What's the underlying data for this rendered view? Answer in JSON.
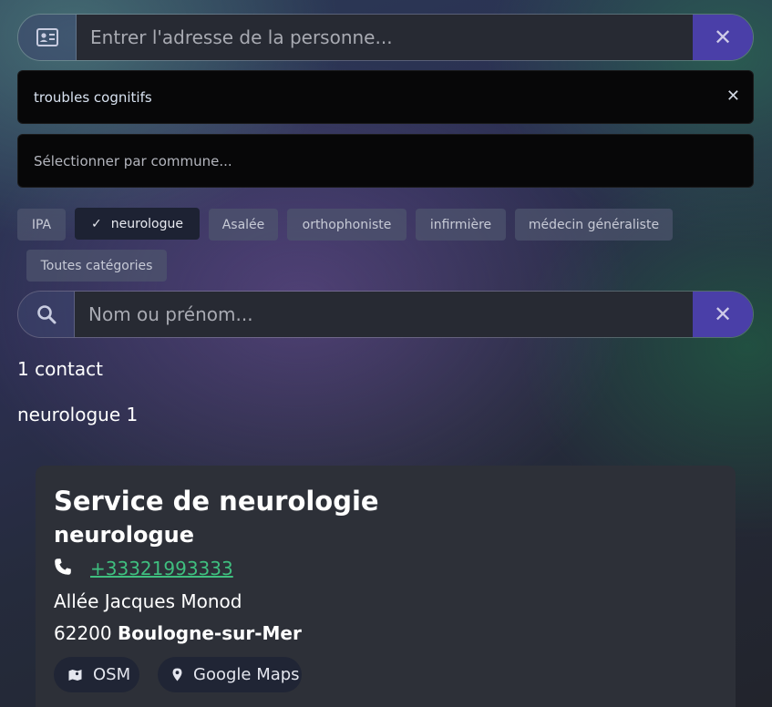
{
  "address_search": {
    "placeholder": "Entrer l'adresse de la personne...",
    "icon": "id-card-icon",
    "clear_icon": "close-icon"
  },
  "keyword_select": {
    "value": "troubles cognitifs",
    "clear_icon": "close-icon"
  },
  "commune_select": {
    "placeholder": "Sélectionner par commune..."
  },
  "categories": [
    {
      "label": "IPA",
      "active": false
    },
    {
      "label": "neurologue",
      "active": true
    },
    {
      "label": "Asalée",
      "active": false
    },
    {
      "label": "orthophoniste",
      "active": false
    },
    {
      "label": "infirmière",
      "active": false
    },
    {
      "label": "médecin généraliste",
      "active": false
    },
    {
      "label": "Toutes catégories",
      "active": false
    }
  ],
  "name_search": {
    "placeholder": "Nom ou prénom...",
    "icon": "search-icon",
    "clear_icon": "close-icon"
  },
  "results": {
    "count_label": "1 contact",
    "group_label": "neurologue 1"
  },
  "contact": {
    "name": "Service de neurologie",
    "category": "neurologue",
    "phone": "+33321993333",
    "street": "Allée Jacques Monod",
    "postcode": "62200",
    "city": "Boulogne-sur-Mer",
    "buttons": {
      "osm": "OSM",
      "google": "Google Maps"
    }
  },
  "colors": {
    "accent": "#4a3fa8",
    "link": "#3fbf7f",
    "card": "#2d3038"
  }
}
